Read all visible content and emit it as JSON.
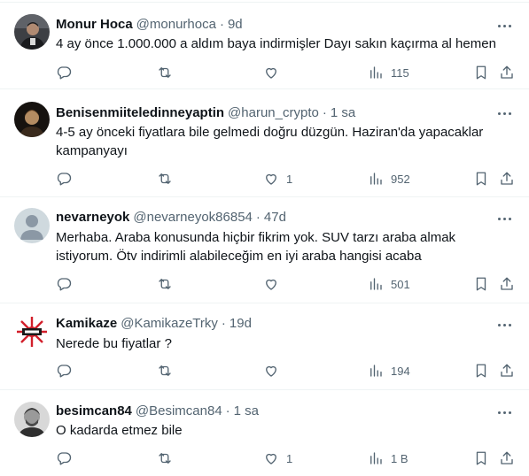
{
  "tweets": [
    {
      "display_name": "Monur Hoca",
      "handle": "@monurhoca",
      "time": "9d",
      "text": "4 ay önce 1.000.000 a aldım baya indirmişler Dayı sakın kaçırma al hemen",
      "replies": "",
      "retweets": "",
      "likes": "",
      "views": "115",
      "avatar": "dark-photo-man"
    },
    {
      "display_name": "Benisenmiiteledinneyaptin",
      "handle": "@harun_crypto",
      "time": "1 sa",
      "text": "4-5 ay önceki fiyatlara bile gelmedi doğru düzgün. Haziran'da yapacaklar kampanyayı",
      "replies": "",
      "retweets": "",
      "likes": "1",
      "views": "952",
      "avatar": "dark-photo-portrait"
    },
    {
      "display_name": "nevarneyok",
      "handle": "@nevarneyok86854",
      "time": "47d",
      "text": "Merhaba. Araba konusunda hiçbir fikrim yok. SUV tarzı araba almak istiyorum. Ötv indirimli alabileceğim en iyi araba hangisi acaba",
      "replies": "",
      "retweets": "",
      "likes": "",
      "views": "501",
      "avatar": "default-profile"
    },
    {
      "display_name": "Kamikaze",
      "handle": "@KamikazeTrky",
      "time": "19d",
      "text": "Nerede bu fiyatlar ?",
      "replies": "",
      "retweets": "",
      "likes": "",
      "views": "194",
      "avatar": "rising-sun-flag"
    },
    {
      "display_name": "besimcan84",
      "handle": "@Besimcan84",
      "time": "1 sa",
      "text": "O kadarda etmez bile",
      "replies": "",
      "retweets": "",
      "likes": "1",
      "views": "1 B",
      "avatar": "photo-man-beard"
    }
  ],
  "separator": "·",
  "icons": [
    "more-icon",
    "reply-icon",
    "retweet-icon",
    "like-icon",
    "views-icon",
    "bookmark-icon",
    "share-icon"
  ],
  "colors": {
    "text": "#0f1419",
    "secondary": "#536471",
    "divider": "#eff3f4",
    "background": "#ffffff"
  }
}
